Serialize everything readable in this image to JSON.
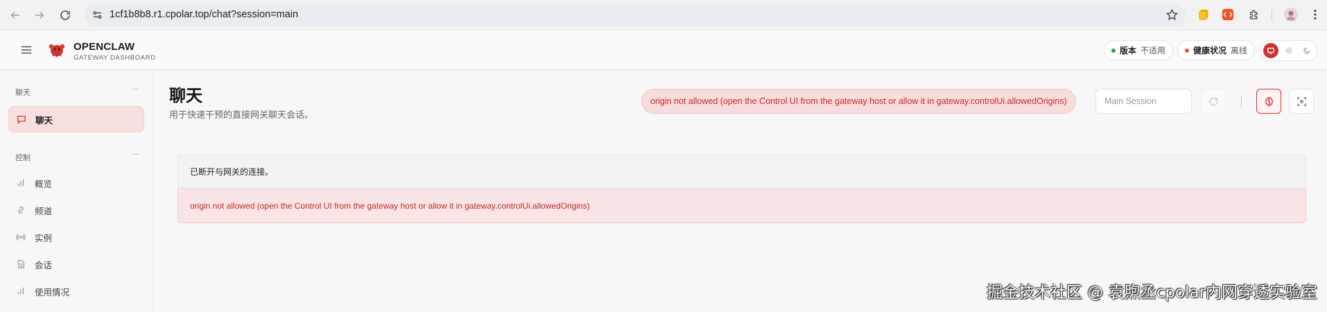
{
  "browser": {
    "url": "1cf1b8b8.r1.cpolar.top/chat?session=main"
  },
  "header": {
    "brand_title": "OPENCLAW",
    "brand_subtitle": "GATEWAY DASHBOARD",
    "version_label": "版本",
    "version_value": "不适用",
    "health_label": "健康状况",
    "health_value": "离线",
    "colors": {
      "accent": "#d32f2f",
      "online_dot": "#2e9d4a",
      "offline_dot": "#e05050"
    }
  },
  "sidebar": {
    "sections": [
      {
        "title": "聊天",
        "items": [
          {
            "label": "聊天",
            "icon": "message-icon",
            "active": true
          }
        ]
      },
      {
        "title": "控制",
        "items": [
          {
            "label": "概览",
            "icon": "bar-chart-icon"
          },
          {
            "label": "频道",
            "icon": "link-icon"
          },
          {
            "label": "实例",
            "icon": "broadcast-icon"
          },
          {
            "label": "会话",
            "icon": "document-icon"
          },
          {
            "label": "使用情况",
            "icon": "bar-chart-icon"
          }
        ]
      }
    ]
  },
  "main": {
    "title": "聊天",
    "subtitle": "用于快速干预的直接网关聊天会话。",
    "error_pill": "origin not allowed (open the Control UI from the gateway host or allow it in gateway.controlUi.allowedOrigins)",
    "session_placeholder": "Main Session",
    "status_text": "已断开与网关的连接。",
    "error_text": "origin not allowed (open the Control UI from the gateway host or allow it in gateway.controlUi.allowedOrigins)"
  },
  "watermark": "掘金技术社区 @ 袁煦丞cpolar内网穿透实验室"
}
